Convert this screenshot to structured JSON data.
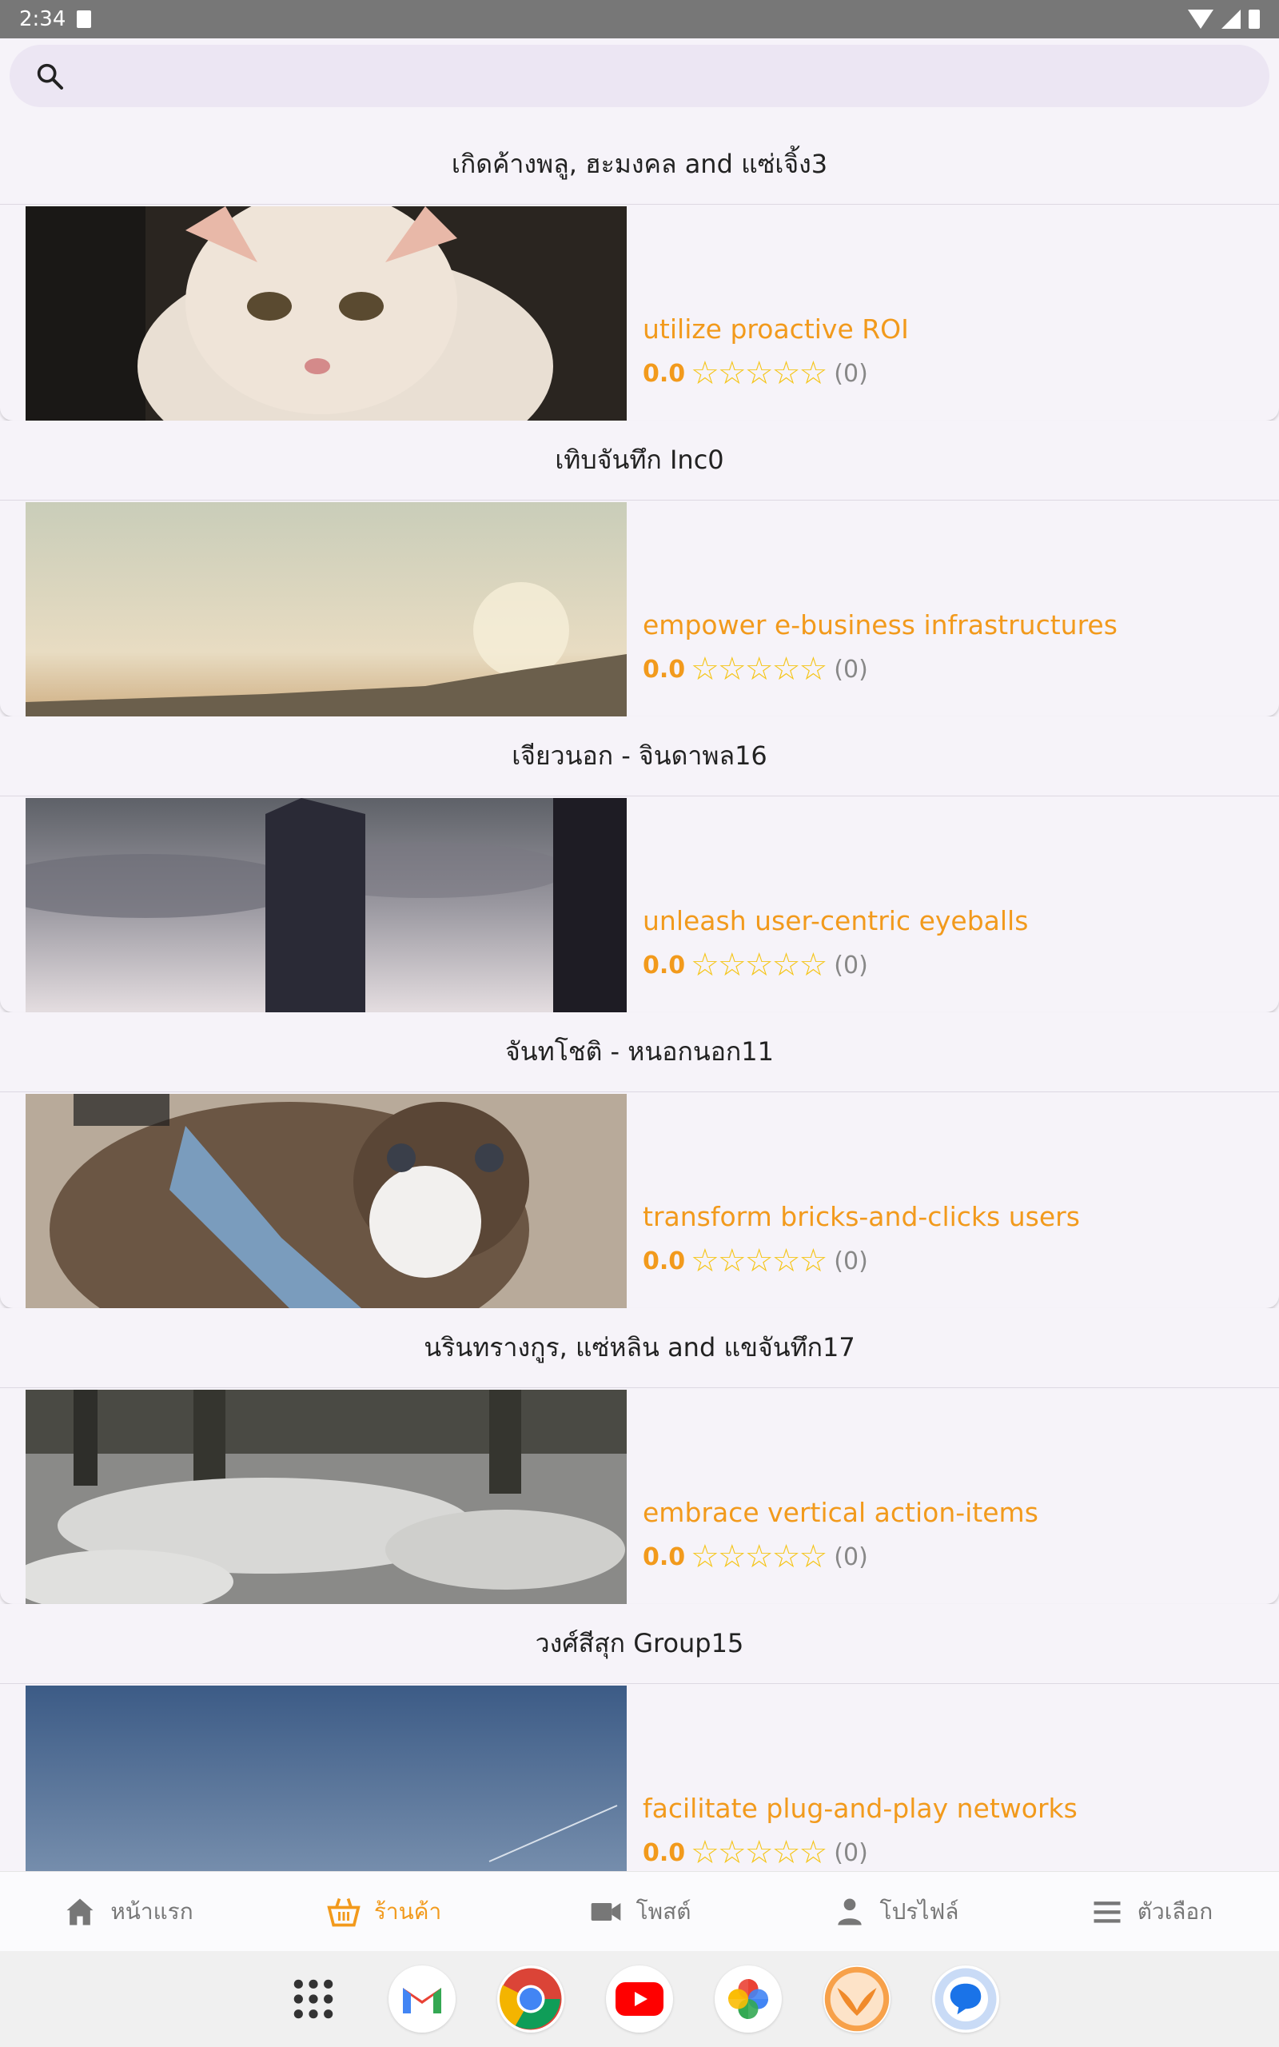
{
  "status_bar": {
    "time": "2:34"
  },
  "search": {
    "placeholder": ""
  },
  "products": [
    {
      "shop": "เกิดค้างพลู, ฮะมงคล and แซ่เจิ้ง3",
      "name": "utilize proactive ROI",
      "rating": "0.0",
      "reviews": "(0)",
      "image": "kitten"
    },
    {
      "shop": "เทิบจันทึก Inc0",
      "name": "empower e-business infrastructures",
      "rating": "0.0",
      "reviews": "(0)",
      "image": "sunset"
    },
    {
      "shop": "เจียวนอก - จินดาพล16",
      "name": "unleash user-centric eyeballs",
      "rating": "0.0",
      "reviews": "(0)",
      "image": "skyscraper"
    },
    {
      "shop": "จันทโชติ - หนอกนอก11",
      "name": "transform bricks-and-clicks users",
      "rating": "0.0",
      "reviews": "(0)",
      "image": "cat-harness"
    },
    {
      "shop": "นรินทรางกูร, แซ่หลิน and แขจันทึก17",
      "name": "embrace vertical action-items",
      "rating": "0.0",
      "reviews": "(0)",
      "image": "snowy-forest"
    },
    {
      "shop": "วงศ์สีสุก Group15",
      "name": "facilitate plug-and-play networks",
      "rating": "0.0",
      "reviews": "(0)",
      "image": "blue-sky"
    }
  ],
  "bottom_nav": {
    "home": "หน้าแรก",
    "shop": "ร้านค้า",
    "post": "โพสต์",
    "profile": "โปรไฟล์",
    "options": "ตัวเลือก"
  },
  "dock": [
    "apps-grid-icon",
    "gmail-icon",
    "chrome-icon",
    "youtube-icon",
    "photos-icon",
    "lasara-icon",
    "messages-icon"
  ],
  "colors": {
    "accent": "#f29a1c",
    "star": "#f5c518",
    "background": "#f6f3f9"
  }
}
